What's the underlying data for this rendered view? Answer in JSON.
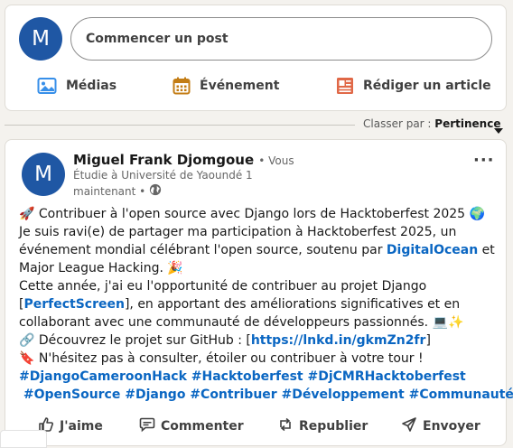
{
  "composer": {
    "avatar_initial": "M",
    "start_post_label": "Commencer un post",
    "actions": {
      "media_label": "Médias",
      "event_label": "Événement",
      "article_label": "Rédiger un article"
    }
  },
  "sort": {
    "label": "Classer par :",
    "value": "Pertinence"
  },
  "post": {
    "author": {
      "avatar_initial": "M",
      "name": "Miguel Frank Djomgoue",
      "relation": "• Vous",
      "headline": "Étudie à Université de Yaoundé 1",
      "time": "maintenant •"
    },
    "more_label": "···",
    "content": {
      "line1": "🚀 Contribuer à l'open source avec Django lors de Hacktoberfest 2025 🌍",
      "line2": "Je suis ravi(e) de partager ma participation à Hacktoberfest 2025, un",
      "line3_before": "événement mondial célébrant l'open source, soutenu par ",
      "line3_link": "DigitalOcean",
      "line3_after": " et",
      "line4": "Major League Hacking. 🎉",
      "line5": "Cette année, j'ai eu l'opportunité de contribuer au projet Django",
      "line6_before": "[",
      "line6_link": "PerfectScreen",
      "line6_after": "], en apportant des améliorations significatives et en",
      "line7": "collaborant avec une communauté de développeurs passionnés. 💻✨",
      "line8_before": "🔗 Découvrez le projet sur GitHub : [",
      "line8_link": "https://lnkd.in/gkmZn2fr",
      "line8_after": "]",
      "line9": "🔖 N'hésitez pas à consulter, étoiler ou contribuer à votre tour !",
      "hashtags_line1": "#DjangoCameroonHack #Hacktoberfest #DjCMRHacktoberfest",
      "hashtags_line2": " #OpenSource #Django #Contribuer #Développement #Communauté"
    },
    "reactions": {
      "like_label": "J'aime",
      "comment_label": "Commenter",
      "repost_label": "Republier",
      "send_label": "Envoyer"
    }
  },
  "icons": {
    "media": "image-icon",
    "event": "calendar-icon",
    "article": "article-icon",
    "caret": "caret-down-icon",
    "globe": "globe-icon",
    "like": "thumbs-up-icon",
    "comment": "comment-icon",
    "repost": "repost-icon",
    "send": "send-icon",
    "more": "more-icon"
  },
  "colors": {
    "brand_blue": "#0a66c2",
    "avatar_bg": "#1f57a4",
    "event_orange": "#c37d16",
    "article_red": "#e06847"
  }
}
